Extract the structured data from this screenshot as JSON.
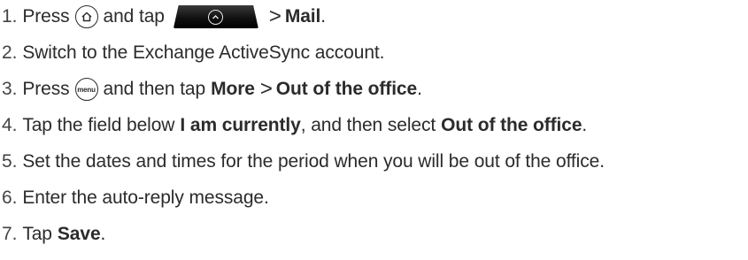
{
  "steps": [
    {
      "num": "1.",
      "t1": "Press",
      "t2": "and tap",
      "sep": ">",
      "t3": "Mail",
      "t4": "."
    },
    {
      "num": "2.",
      "t1": "Switch to the Exchange ActiveSync account."
    },
    {
      "num": "3.",
      "t1": "Press",
      "t2": "and then tap",
      "b1": "More",
      "sep": ">",
      "b2": "Out of the office",
      "t3": "."
    },
    {
      "num": "4.",
      "t1": "Tap the field below",
      "b1": "I am currently",
      "t2": ", and then select",
      "b2": "Out of the office",
      "t3": "."
    },
    {
      "num": "5.",
      "t1": "Set the dates and times for the period when you will be out of the office."
    },
    {
      "num": "6.",
      "t1": "Enter the auto-reply message."
    },
    {
      "num": "7.",
      "t1": "Tap",
      "b1": "Save",
      "t2": "."
    }
  ],
  "icons": {
    "home": "home-icon",
    "launcher": "all-apps-launcher-icon",
    "menu": "menu-button-icon",
    "menu_label": "menu"
  }
}
